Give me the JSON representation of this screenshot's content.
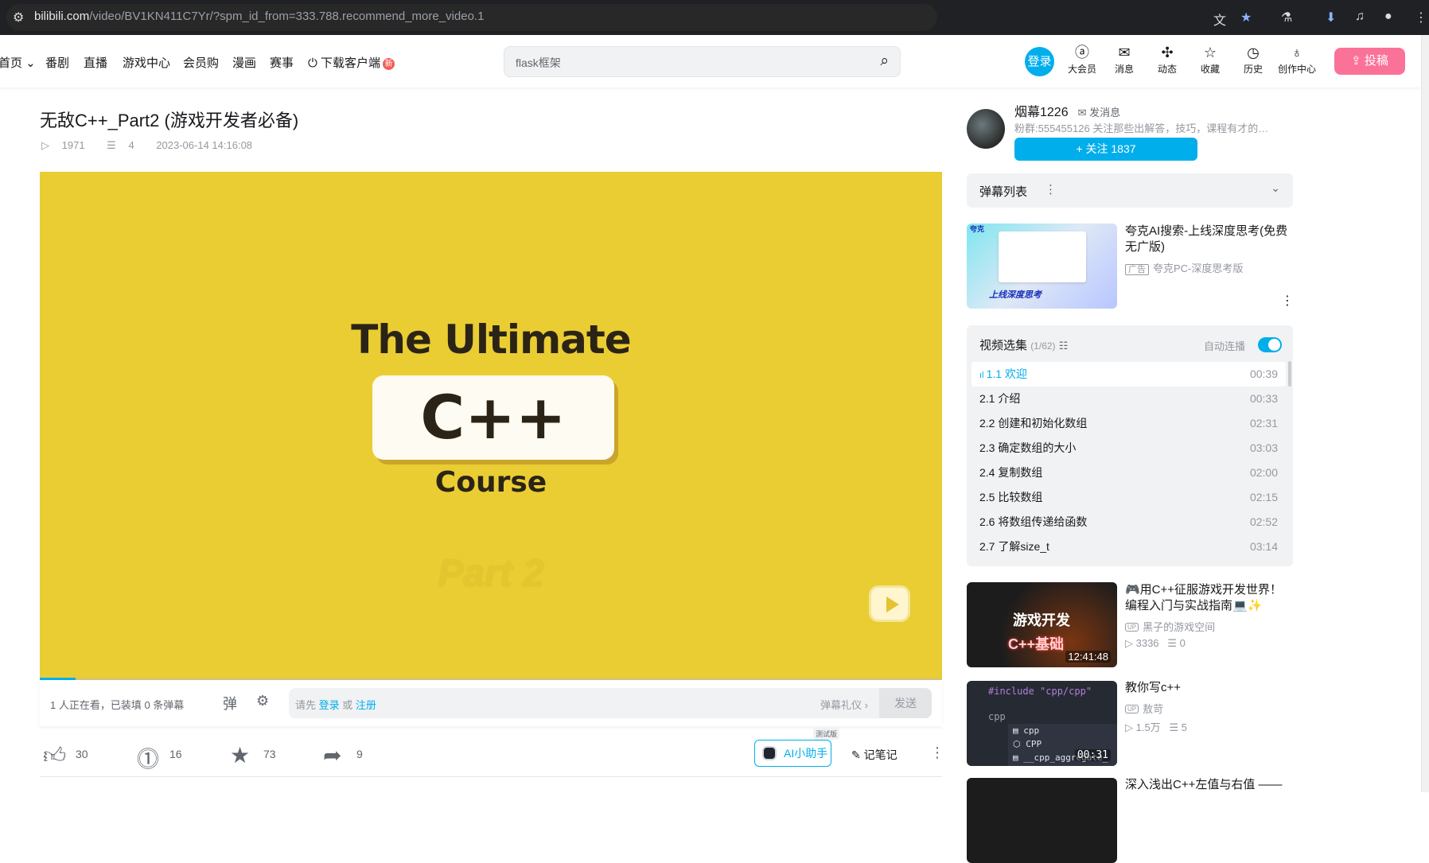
{
  "browser": {
    "url_domain": "bilibili.com",
    "url_path": "/video/BV1KN411C7Yr/?spm_id_from=333.788.recommend_more_video.1",
    "icons": [
      "site-info-icon",
      "translate-icon",
      "bookmark-star-icon",
      "labs-flask-icon",
      "download-icon",
      "media-queue-icon",
      "profile-icon",
      "menu-icon"
    ]
  },
  "nav": {
    "items": [
      "首页",
      "番剧",
      "直播",
      "游戏中心",
      "会员购",
      "漫画",
      "赛事"
    ],
    "download": "下载客户端",
    "download_badge": "新",
    "search_placeholder": "flask框架",
    "login": "登录",
    "tools": [
      {
        "label": "大会员",
        "icon": "vip-icon"
      },
      {
        "label": "消息",
        "icon": "mail-icon"
      },
      {
        "label": "动态",
        "icon": "pinwheel-icon"
      },
      {
        "label": "收藏",
        "icon": "star-icon"
      },
      {
        "label": "历史",
        "icon": "clock-icon"
      },
      {
        "label": "创作中心",
        "icon": "bulb-icon"
      }
    ],
    "upload": "投稿"
  },
  "video": {
    "title": "无敌C++_Part2 (游戏开发者必备)",
    "views": "1971",
    "danmaku_count": "4",
    "date": "2023-06-14 14:16:08",
    "frame": {
      "line1": "The Ultimate",
      "line2": "C++",
      "line3": "Course",
      "line4": "Part 2"
    },
    "progress_percent": 4,
    "accent": "#00aeec"
  },
  "danmaku_bar": {
    "watching": "1 人正在看，已装填 0 条弹幕",
    "prompt_prefix": "请先",
    "login": "登录",
    "or": "或",
    "register": "注册",
    "etiquette": "弹幕礼仪 ›",
    "send": "发送"
  },
  "actions": {
    "like": "30",
    "coin": "16",
    "favorite": "73",
    "share": "9",
    "ai_assistant": "AI小助手",
    "beta": "测试版",
    "note": "记笔记"
  },
  "uploader": {
    "name": "烟幕1226",
    "message": "发消息",
    "fans": "粉群:555455126 关注那些出解答，技巧，课程有才的…",
    "follow": "+ 关注 1837"
  },
  "danmaku_list": {
    "label": "弹幕列表"
  },
  "ad": {
    "title": "夸克AI搜索-上线深度思考(免费无广版)",
    "tag": "广告",
    "source": "夸克PC-深度思考版",
    "image_banner": "上线深度思考",
    "image_logo": "夸克"
  },
  "episodes": {
    "title": "视频选集",
    "count": "(1/62)",
    "autoplay": "自动连播",
    "autoplay_on": true,
    "items": [
      {
        "label": "1.1 欢迎",
        "duration": "00:39",
        "active": true
      },
      {
        "label": "2.1 介绍",
        "duration": "00:33"
      },
      {
        "label": "2.2 创建和初始化数组",
        "duration": "02:31"
      },
      {
        "label": "2.3 确定数组的大小",
        "duration": "03:03"
      },
      {
        "label": "2.4 复制数组",
        "duration": "02:00"
      },
      {
        "label": "2.5 比较数组",
        "duration": "02:15"
      },
      {
        "label": "2.6 将数组传递给函数",
        "duration": "02:52"
      },
      {
        "label": "2.7 了解size_t",
        "duration": "03:14"
      }
    ]
  },
  "recommendations": [
    {
      "title": "🎮用C++征服游戏开发世界！编程入门与实战指南💻✨",
      "up": "黑子的游戏空间",
      "views": "3336",
      "danmaku": "0",
      "duration": "12:41:48",
      "thumb_text1": "游戏开发",
      "thumb_text2": "C++基础"
    },
    {
      "title": "教你写c++",
      "up": "敖苛",
      "views": "1.5万",
      "danmaku": "5",
      "duration": "00:31",
      "thumb_code": "#include \"cpp/cpp\"",
      "thumb_line": "cpp",
      "thumb_items": [
        "cpp",
        "CPP",
        "__cpp_aggregate_"
      ]
    },
    {
      "title": "深入浅出C++左值与右值 ——"
    }
  ]
}
